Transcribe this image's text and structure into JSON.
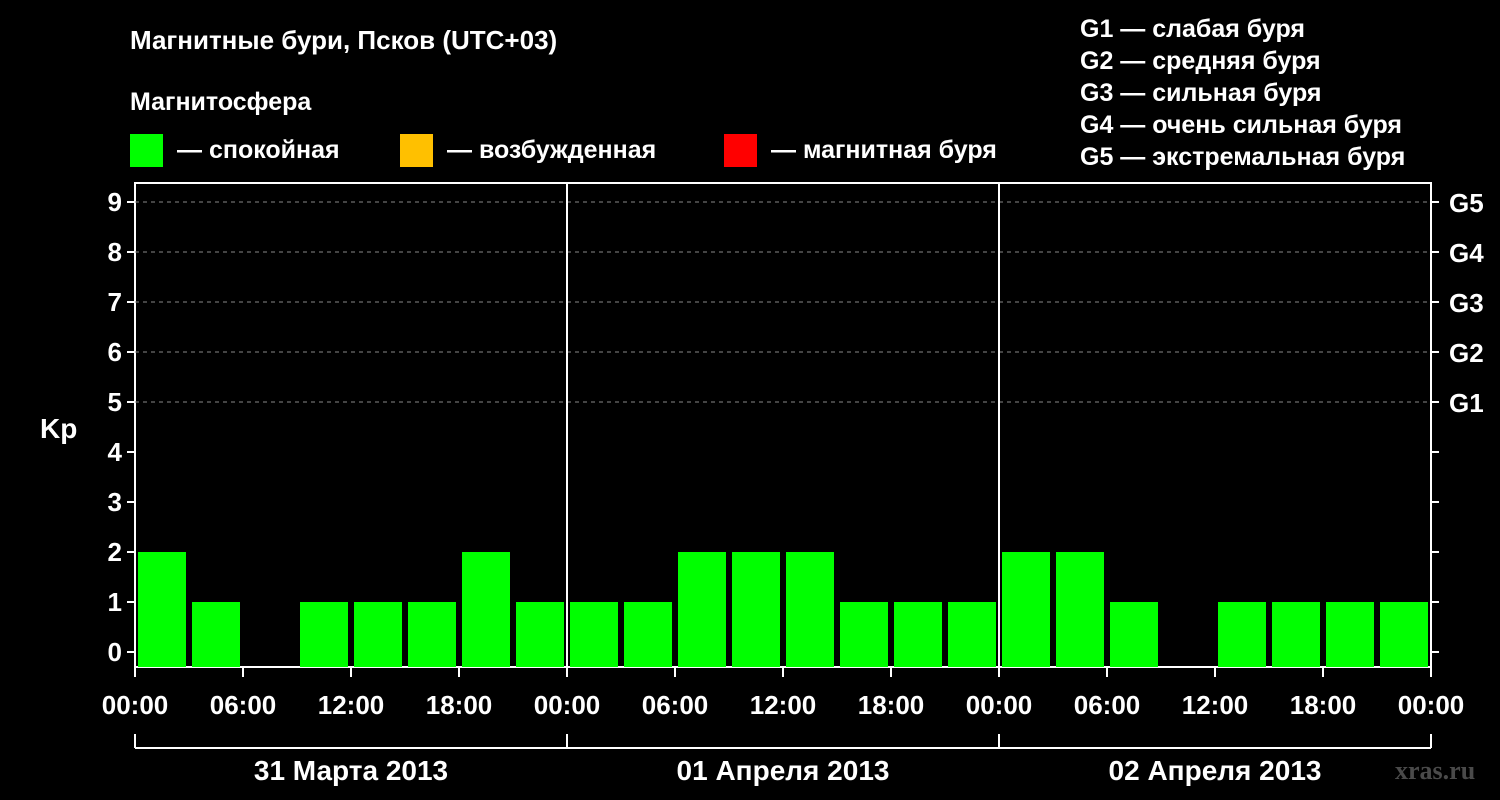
{
  "chart_data": {
    "type": "bar",
    "title": "Магнитные бури, Псков (UTC+03)",
    "subtitle": "Магнитосфера",
    "ylabel": "Kp",
    "ylim": [
      0,
      9
    ],
    "yticks": [
      "0",
      "1",
      "2",
      "3",
      "4",
      "5",
      "6",
      "7",
      "8",
      "9"
    ],
    "grid": "dashed at Kp 5-9",
    "right_axis_labels": [
      {
        "kp": 5,
        "label": "G1"
      },
      {
        "kp": 6,
        "label": "G2"
      },
      {
        "kp": 7,
        "label": "G3"
      },
      {
        "kp": 8,
        "label": "G4"
      },
      {
        "kp": 9,
        "label": "G5"
      }
    ],
    "legend_levels": [
      {
        "color": "#00ff00",
        "label": "— спокойная"
      },
      {
        "color": "#ffc000",
        "label": "— возбужденная"
      },
      {
        "color": "#ff0000",
        "label": "— магнитная буря"
      }
    ],
    "storm_legend": [
      "G1 — слабая буря",
      "G2 — средняя буря",
      "G3 — сильная буря",
      "G4 — очень сильная буря",
      "G5 — экстремальная буря"
    ],
    "xtick_labels": [
      "00:00",
      "06:00",
      "12:00",
      "18:00",
      "00:00",
      "06:00",
      "12:00",
      "18:00",
      "00:00",
      "06:00",
      "12:00",
      "18:00",
      "00:00"
    ],
    "days": [
      "31 Марта 2013",
      "01 Апреля 2013",
      "02 Апреля 2013"
    ],
    "interval_hours": 3,
    "values": [
      2,
      1,
      0,
      1,
      1,
      1,
      2,
      1,
      1,
      1,
      2,
      2,
      2,
      1,
      1,
      1,
      2,
      2,
      1,
      0,
      1,
      1,
      1,
      1
    ],
    "bar_color": "#00ff00"
  },
  "watermark": "xras.ru"
}
